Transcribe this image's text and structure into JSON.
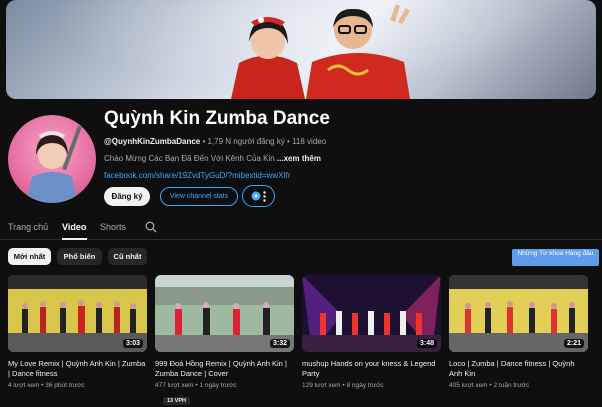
{
  "channel": {
    "name": "Quỳnh Kin Zumba Dance",
    "handle": "@QuynhKinZumbaDance",
    "stats": " • 1,79 N người đăng ký • 118 video",
    "description": "Chào Mừng Các Bạn Đã Đến Với Kênh Của Kin ",
    "description_more": "...xem thêm",
    "link": "facebook.com/share/19ZvdTyGuD/?mibextid=wwXIfr"
  },
  "buttons": {
    "subscribe": "Đăng ký",
    "stats": "View channel stats"
  },
  "tabs": [
    {
      "label": "Trang chủ"
    },
    {
      "label": "Video"
    },
    {
      "label": "Shorts"
    }
  ],
  "filters": [
    {
      "label": "Mới nhất"
    },
    {
      "label": "Phổ biến"
    },
    {
      "label": "Cũ nhất"
    }
  ],
  "tooltip": "Những Từ khoá Hàng đầu",
  "videos": [
    {
      "title": "My Love Remix | Quỳnh Anh Kin | Zumba | Dance fitness",
      "meta": "4 lượt xem • 36 phút trước",
      "duration": "3:03",
      "badge": ""
    },
    {
      "title": "999 Đoá Hồng Remix | Quỳnh Anh Kin | Zumba Dance | Cover",
      "meta": "477 lượt xem • 1 ngày trước",
      "duration": "3:32",
      "badge": "13 VPH"
    },
    {
      "title": "mushup Hands on your kness & Legend Party",
      "meta": "129 lượt xem • 8 ngày trước",
      "duration": "3:48",
      "badge": ""
    },
    {
      "title": "Loco | Zumba | Dance fitness | Quỳnh Anh Kin",
      "meta": "405 lượt xem • 2 tuần trước",
      "duration": "2:21",
      "badge": ""
    }
  ],
  "colors": {
    "background": "#0f0f0f",
    "link": "#3ea6ff",
    "tooltip": "#5e9cec"
  }
}
